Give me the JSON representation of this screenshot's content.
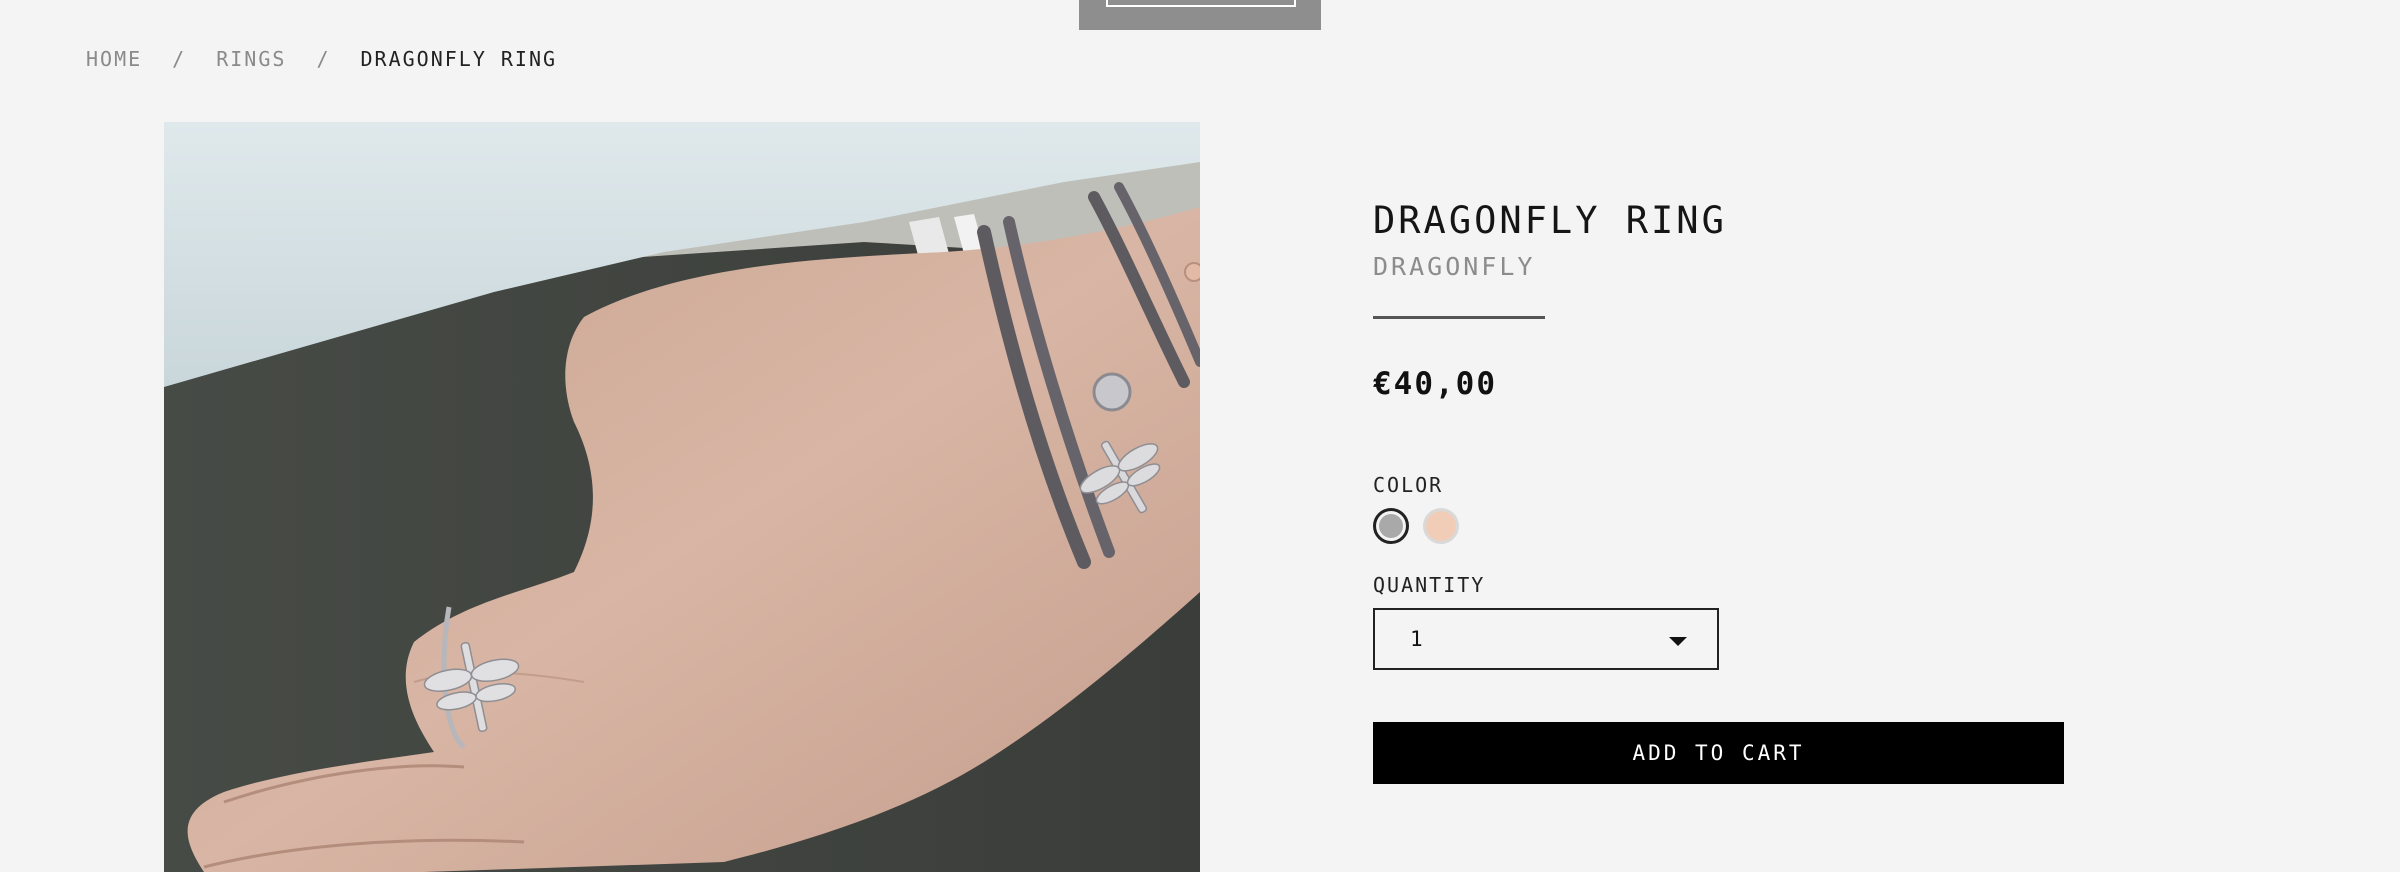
{
  "breadcrumb": {
    "home": "HOME",
    "separator": "/",
    "category": "RINGS",
    "current": "DRAGONFLY RING"
  },
  "product": {
    "title": "DRAGONFLY RING",
    "collection": "DRAGONFLY",
    "price": "€40,00",
    "color_label": "COLOR",
    "colors": [
      {
        "name": "silver",
        "hex": "#a9a9a9",
        "selected": true
      },
      {
        "name": "rose",
        "hex": "#f1cdb8",
        "selected": false
      }
    ],
    "quantity_label": "QUANTITY",
    "quantity_value": "1",
    "add_to_cart": "ADD TO CART"
  },
  "colors": {
    "background": "#f4f4f4",
    "button": "#000000",
    "muted_text": "#8a8a8a"
  }
}
